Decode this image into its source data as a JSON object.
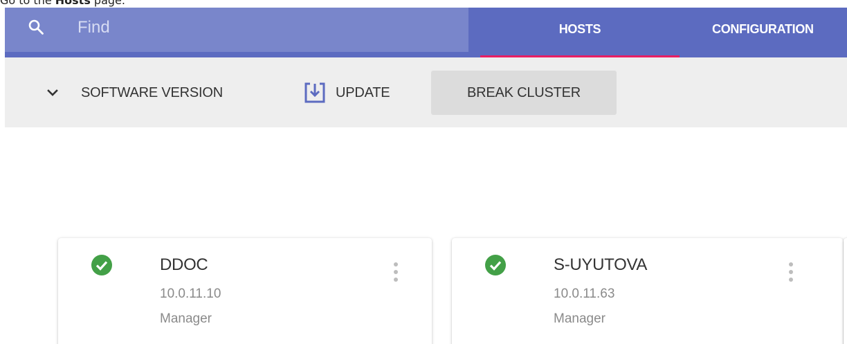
{
  "instruction": {
    "prefix": "Go to the ",
    "emphasis": "Hosts",
    "suffix": " page."
  },
  "search": {
    "icon": "search-icon",
    "placeholder": "Find",
    "value": ""
  },
  "tabs": [
    {
      "label": "HOSTS",
      "active": true
    },
    {
      "label": "CONFIGURATION",
      "active": false
    }
  ],
  "toolbar": {
    "software_version_label": "SOFTWARE VERSION",
    "update_label": "UPDATE",
    "break_cluster_label": "BREAK CLUSTER"
  },
  "hosts": [
    {
      "name": "DDOC",
      "ip": "10.0.11.10",
      "role": "Manager",
      "status": "ok"
    },
    {
      "name": "S-UYUTOVA",
      "ip": "10.0.11.63",
      "role": "Manager",
      "status": "ok"
    }
  ],
  "colors": {
    "topbar": "#5c6bc0",
    "search_bg": "#7986cb",
    "active_tab_indicator": "#e91e63",
    "toolbar_bg": "#eeeeee",
    "status_ok": "#43a047"
  }
}
